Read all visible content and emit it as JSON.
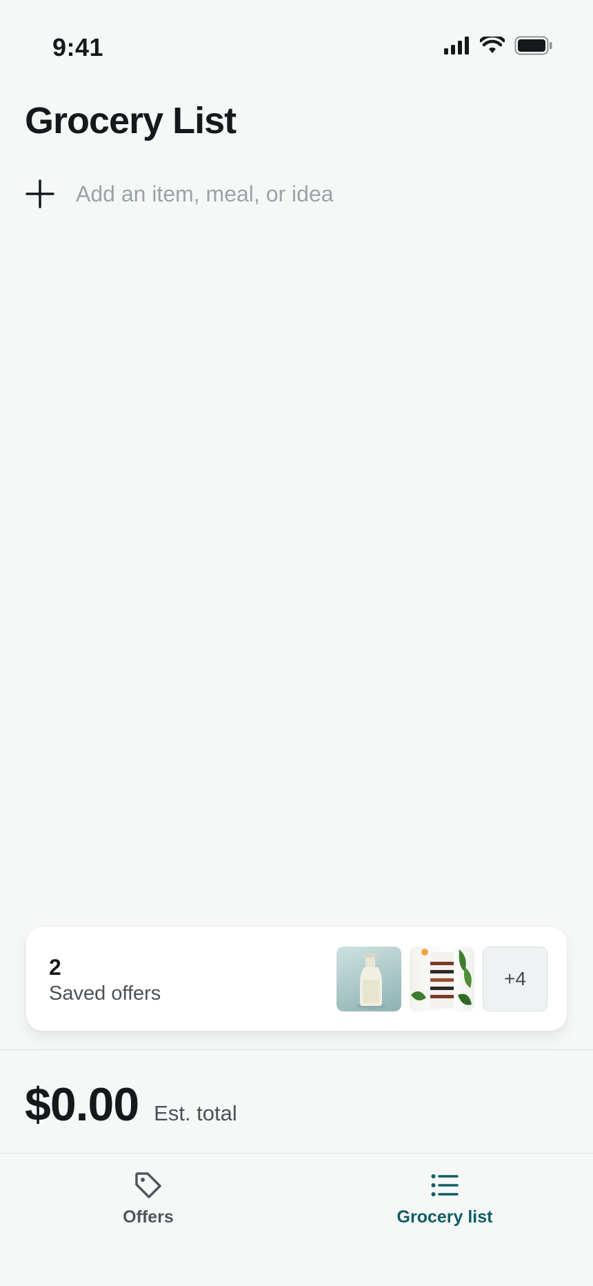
{
  "status_bar": {
    "time": "9:41",
    "icons": [
      "signal-icon",
      "wifi-icon",
      "battery-icon"
    ]
  },
  "page": {
    "title": "Grocery List"
  },
  "add_item": {
    "icon": "plus-icon",
    "placeholder": "Add an item, meal, or idea",
    "value": ""
  },
  "saved_offers": {
    "count": "2",
    "label": "Saved offers",
    "thumbnails": [
      "milk-bottle-thumbnail",
      "jar-plant-thumbnail"
    ],
    "more_label": "+4"
  },
  "total": {
    "amount": "$0.00",
    "label": "Est. total"
  },
  "tab_bar": {
    "tabs": [
      {
        "label": "Offers",
        "icon": "tag-icon",
        "active": false
      },
      {
        "label": "Grocery list",
        "icon": "list-icon",
        "active": true
      }
    ]
  },
  "colors": {
    "background": "#f6f8f8",
    "accent": "#0e5e63",
    "placeholder": "#9aa3a7"
  }
}
